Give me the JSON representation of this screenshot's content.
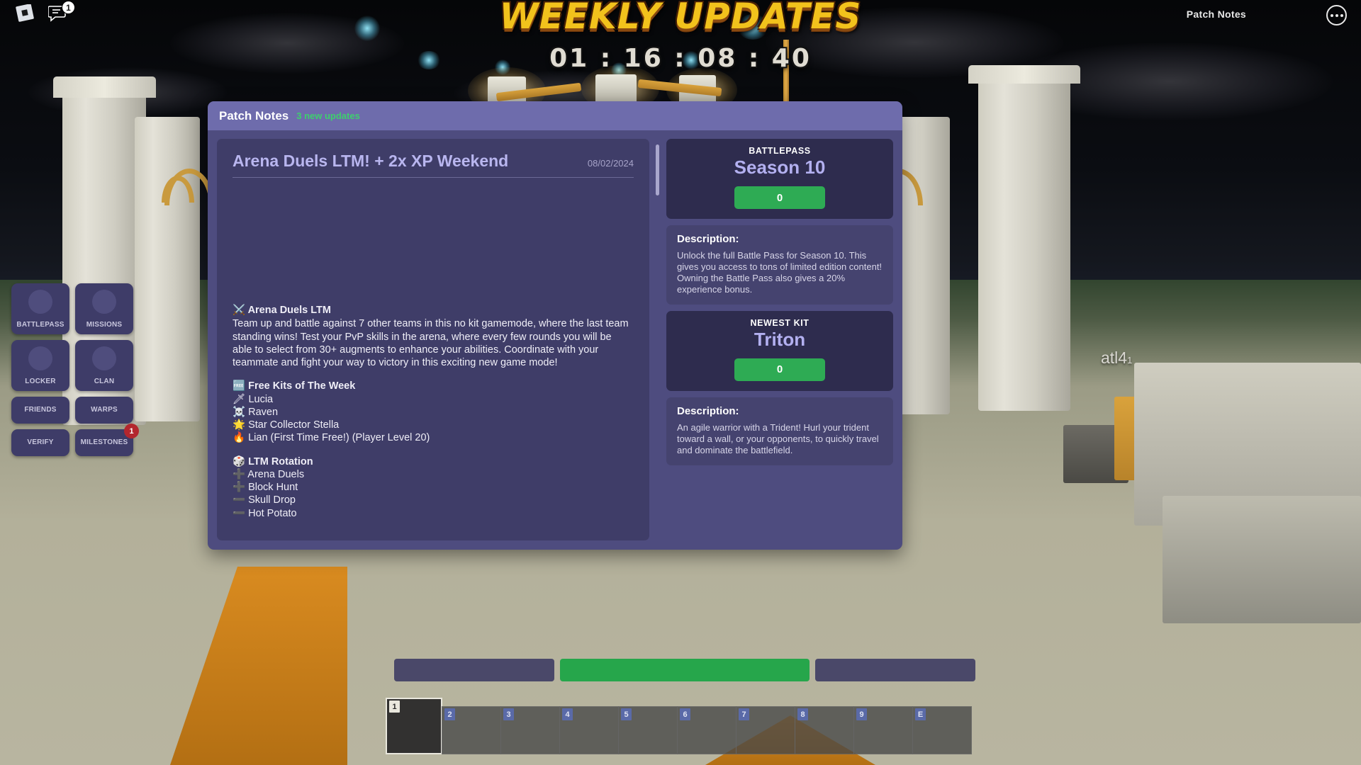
{
  "topbar": {
    "roblox_icon": "roblox-logo-icon",
    "chat_icon": "chat-icon",
    "chat_badge": "1",
    "title": "Patch Notes",
    "more_icon": "more-options-icon"
  },
  "banner": {
    "title": "WEEKLY UPDATES",
    "timer": "01 : 16 : 08 : 40"
  },
  "left_menu": {
    "items": [
      {
        "label": "BATTLEPASS",
        "icon": "battlepass-icon",
        "has_icon": true,
        "badge": ""
      },
      {
        "label": "MISSIONS",
        "icon": "missions-icon",
        "has_icon": true,
        "badge": ""
      },
      {
        "label": "LOCKER",
        "icon": "locker-icon",
        "has_icon": true,
        "badge": ""
      },
      {
        "label": "CLAN",
        "icon": "clan-icon",
        "has_icon": true,
        "badge": ""
      },
      {
        "label": "FRIENDS",
        "icon": "friends-icon",
        "has_icon": false,
        "badge": ""
      },
      {
        "label": "WARPS",
        "icon": "warps-icon",
        "has_icon": false,
        "badge": ""
      },
      {
        "label": "VERIFY",
        "icon": "verify-icon",
        "has_icon": false,
        "badge": ""
      },
      {
        "label": "MILESTONES",
        "icon": "milestones-icon",
        "has_icon": false,
        "badge": "1"
      }
    ]
  },
  "nametag": {
    "name": "atl4",
    "suffix": "1"
  },
  "modal": {
    "title": "Patch Notes",
    "subtitle": "3 new updates",
    "article": {
      "title": "Arena Duels LTM! + 2x XP Weekend",
      "date": "08/02/2024",
      "sections": [
        {
          "emoji": "⚔️",
          "heading": "Arena Duels LTM",
          "paragraph": "Team up and battle against 7 other teams in this no kit gamemode, where the last team standing wins! Test your PvP skills in the arena, where every few rounds you will be able to select from 30+ augments to enhance your abilities. Coordinate with your teammate and fight your way to victory in this exciting new game mode!",
          "items": []
        },
        {
          "emoji": "🆓",
          "heading": "Free Kits of The Week",
          "paragraph": "",
          "items": [
            {
              "emoji": "🗡",
              "text": "Lucia"
            },
            {
              "emoji": "☠️",
              "text": "Raven"
            },
            {
              "emoji": "🌟",
              "text": "Star Collector Stella"
            },
            {
              "emoji": "🔥",
              "text": "Lian (First Time Free!) (Player Level 20)"
            }
          ]
        },
        {
          "emoji": "🎲",
          "heading": "LTM Rotation",
          "paragraph": "",
          "items": [
            {
              "emoji": "➕",
              "text": "Arena Duels"
            },
            {
              "emoji": "➕",
              "text": "Block Hunt"
            },
            {
              "emoji": "➖",
              "text": "Skull Drop"
            },
            {
              "emoji": "➖",
              "text": "Hot Potato"
            }
          ]
        }
      ]
    },
    "promos": [
      {
        "kicker": "BATTLEPASS",
        "name": "Season 10",
        "button_label": "0",
        "desc_title": "Description:",
        "desc_text": "Unlock the full Battle Pass for Season 10. This gives you access to tons of limited edition content! Owning the Battle Pass also gives a 20% experience bonus."
      },
      {
        "kicker": "NEWEST KIT",
        "name": "Triton",
        "button_label": "0",
        "desc_title": "Description:",
        "desc_text": "An agile warrior with a Trident! Hurl your trident toward a wall, or your opponents, to quickly travel and dominate the battlefield."
      }
    ]
  },
  "hotbar": {
    "slots": [
      "1",
      "2",
      "3",
      "4",
      "5",
      "6",
      "7",
      "8",
      "9",
      "E"
    ],
    "selected_index": 0
  },
  "colors": {
    "accent_purple": "#6e6cac",
    "panel_purple": "#4e4c7f",
    "card_dark": "#2e2c4e",
    "green": "#2eab54",
    "green_text": "#3ecf6d",
    "light_purple_text": "#b3b0f0",
    "badge_red": "#b3262e",
    "banner_yellow": "#f2c21c"
  }
}
